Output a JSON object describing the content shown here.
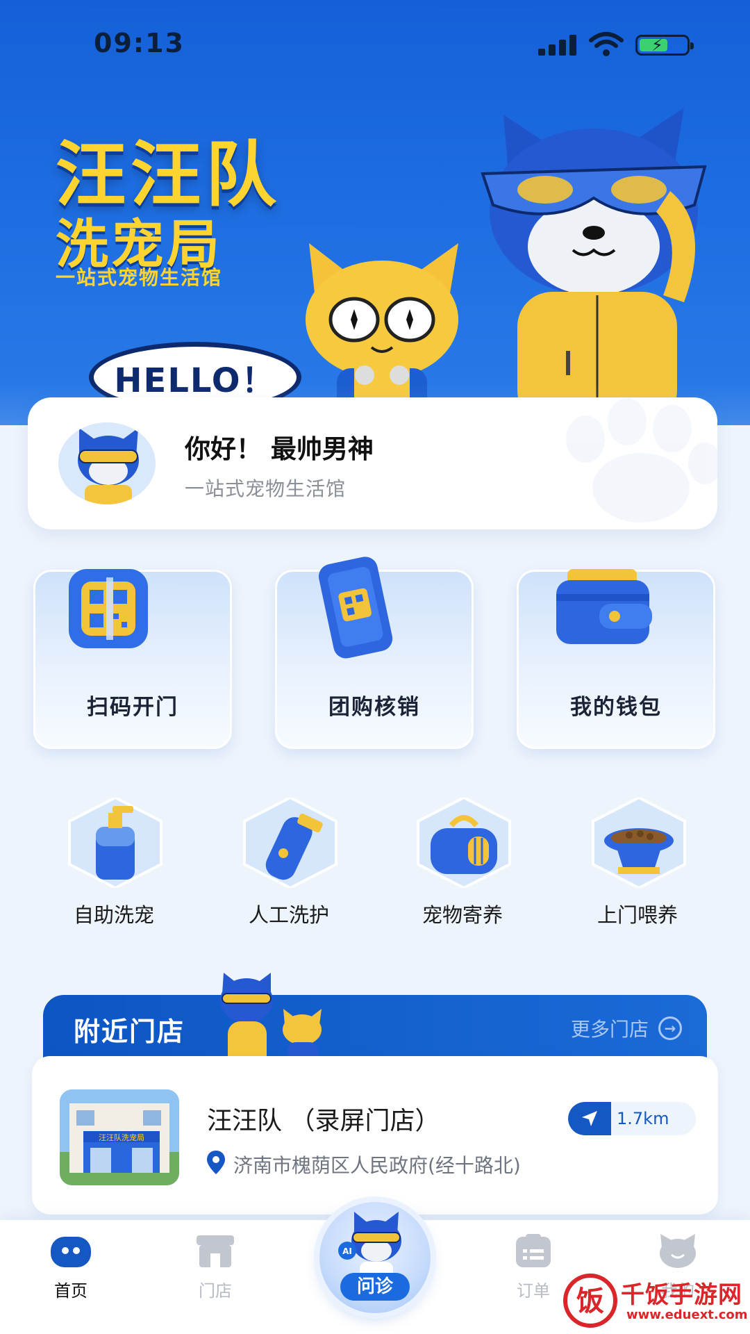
{
  "status_bar": {
    "time": "09:13"
  },
  "hero": {
    "brand_title": "汪汪队",
    "brand_subtitle": "洗宠局",
    "brand_tagline": "一站式宠物生活馆",
    "hello_text": "HELLO！"
  },
  "greeting": {
    "title": "你好！ 最帅男神",
    "subtitle": "一站式宠物生活馆"
  },
  "quick_actions": [
    {
      "label": "扫码开门",
      "icon": "qr-scan-icon"
    },
    {
      "label": "团购核销",
      "icon": "phone-qr-icon"
    },
    {
      "label": "我的钱包",
      "icon": "wallet-icon"
    }
  ],
  "services": [
    {
      "label": "自助洗宠",
      "icon": "shampoo-bottle-icon"
    },
    {
      "label": "人工洗护",
      "icon": "clipper-icon"
    },
    {
      "label": "宠物寄养",
      "icon": "pet-carrier-icon"
    },
    {
      "label": "上门喂养",
      "icon": "food-bowl-icon"
    }
  ],
  "nearby": {
    "title": "附近门店",
    "more_label": "更多门店",
    "store": {
      "name": "汪汪队 （录屏门店）",
      "address": "济南市槐荫区人民政府(经十路北)",
      "distance": "1.7km",
      "storefront_sign": "汪汪队洗宠局"
    }
  },
  "tabbar": {
    "tabs": [
      {
        "label": "首页",
        "icon": "home-icon",
        "active": true
      },
      {
        "label": "门店",
        "icon": "store-icon",
        "active": false
      },
      {
        "label": "问诊",
        "icon": "ai-consult-icon",
        "active": false
      },
      {
        "label": "订单",
        "icon": "order-icon",
        "active": false
      },
      {
        "label": "我的",
        "icon": "profile-icon",
        "active": false
      }
    ],
    "center_badge": "AI"
  },
  "watermark": {
    "title": "千饭手游网",
    "url": "www.eduext.com",
    "logo_char": "饭"
  },
  "colors": {
    "primary": "#1557c3",
    "accent_yellow": "#ffd430",
    "background": "#eef4fc"
  }
}
